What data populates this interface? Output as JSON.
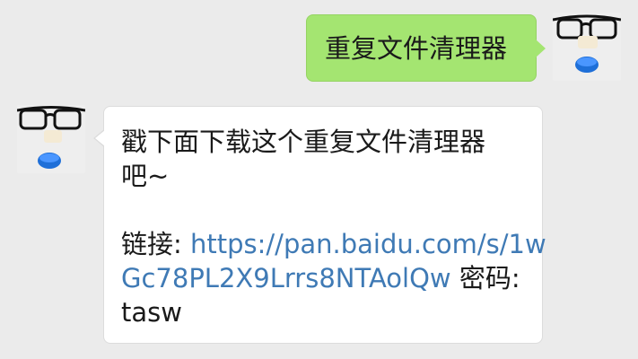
{
  "chat": {
    "outgoing": {
      "text": "重复文件清理器"
    },
    "incoming": {
      "line1": "戳下面下载这个重复文件清理器",
      "line2": "吧~",
      "link_label": "链接: ",
      "link_url_part1": "https://pan.baidu.com/s/1w",
      "link_url_part2": "Gc78PL2X9Lrrs8NTAolQw",
      "password_label": " 密码:",
      "password_value": "tasw"
    }
  },
  "colors": {
    "outgoing_bubble": "#a4e571",
    "incoming_bubble": "#ffffff",
    "link": "#3f7ab5",
    "background": "#ebebeb"
  },
  "icons": {
    "avatar": "glasses-eraser-bottlecap-avatar"
  }
}
